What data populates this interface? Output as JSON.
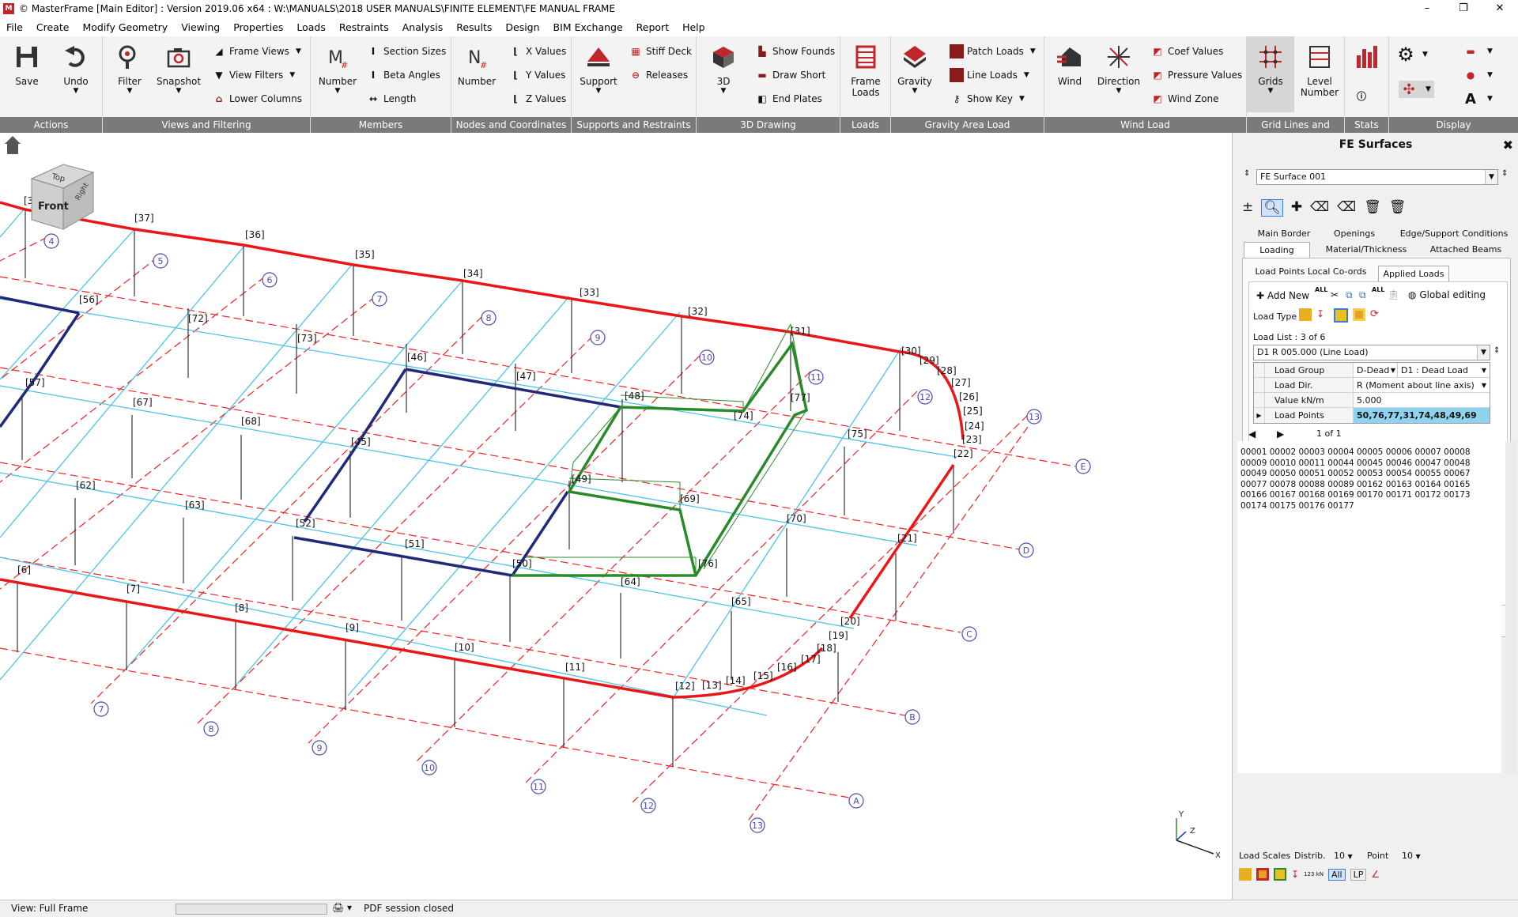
{
  "window": {
    "title": "© MasterFrame [Main Editor] : Version 2019.06 x64 : W:\\MANUALS\\2018 USER MANUALS\\FINITE ELEMENT\\FE MANUAL FRAME",
    "app_icon": "M",
    "controls": [
      "–",
      "❐",
      "✕"
    ]
  },
  "menu": [
    "File",
    "Create",
    "Modify Geometry",
    "Viewing",
    "Properties",
    "Loads",
    "Restraints",
    "Analysis",
    "Results",
    "Design",
    "BIM Exchange",
    "Report",
    "Help"
  ],
  "ribbon": {
    "groups": [
      "Actions",
      "Views and Filtering",
      "Members",
      "Nodes and Coordinates",
      "Supports and Restraints",
      "3D Drawing",
      "Loads",
      "Gravity Area Load",
      "Wind Load",
      "Grid Lines and Levels",
      "Stats",
      "Display"
    ],
    "save": "Save",
    "undo": "Undo",
    "filter": "Filter",
    "snapshot": "Snapshot",
    "frame_views": "Frame Views",
    "view_filters": "View Filters",
    "lower_columns": "Lower Columns",
    "number": "Number",
    "section_sizes": "Section Sizes",
    "beta_angles": "Beta Angles",
    "length": "Length",
    "node_number": "Number",
    "x_values": "X Values",
    "y_values": "Y Values",
    "z_values": "Z Values",
    "support": "Support",
    "stiff_deck": "Stiff Deck",
    "releases": "Releases",
    "three_d": "3D",
    "show_founds": "Show Founds",
    "draw_short": "Draw Short",
    "end_plates": "End Plates",
    "frame_loads": "Frame Loads",
    "gravity": "Gravity",
    "patch_loads": "Patch Loads",
    "line_loads": "Line Loads",
    "show_key": "Show Key",
    "wind": "Wind",
    "direction": "Direction",
    "coef_values": "Coef Values",
    "pressure_values": "Pressure Values",
    "wind_zone": "Wind Zone",
    "grids": "Grids",
    "level_number": "Level Number"
  },
  "canvas": {
    "view_cube": {
      "top": "Top",
      "front": "Front",
      "right": "Right"
    },
    "axis": {
      "x": "X",
      "y": "Y",
      "z": "Z"
    },
    "node_labels": [
      "[3]",
      "[37]",
      "[36]",
      "[35]",
      "[34]",
      "[33]",
      "[32]",
      "[31]",
      "[30]",
      "[29]",
      "[28]",
      "[27]",
      "[26]",
      "[25]",
      "[24]",
      "[23]",
      "[22]",
      "[21]",
      "[20]",
      "[19]",
      "[18]",
      "[17]",
      "[16]",
      "[15]",
      "[14]",
      "[13]",
      "[12]",
      "[11]",
      "[10]",
      "[9]",
      "[8]",
      "[7]",
      "[6]",
      "[56]",
      "[57]",
      "[72]",
      "[73]",
      "[46]",
      "[47]",
      "[48]",
      "[74]",
      "[77]",
      "[75]",
      "[67]",
      "[68]",
      "[45]",
      "[62]",
      "[63]",
      "[52]",
      "[51]",
      "[49]",
      "[69]",
      "[70]",
      "[50]",
      "[64]",
      "[76]",
      "[65]"
    ],
    "grid_bubbles": [
      "4",
      "5",
      "6",
      "7",
      "8",
      "9",
      "10",
      "11",
      "12",
      "13",
      "7",
      "8",
      "9",
      "10",
      "11",
      "12",
      "13",
      "A",
      "B",
      "C",
      "D",
      "E"
    ]
  },
  "panel": {
    "title": "FE Surfaces",
    "surface_select": "FE Surface 001",
    "tabs_row1": [
      "Main Border",
      "Openings",
      "Edge/Support Conditions"
    ],
    "tabs_row2": [
      "Loading",
      "Material/Thickness",
      "Attached Beams"
    ],
    "subtabs": [
      "Load Points Local Co-ords",
      "Applied Loads"
    ],
    "add_new": "Add New",
    "all_label": "ALL",
    "global_editing": "Global editing",
    "load_type_label": "Load Type",
    "load_list_label": "Load List :  3 of 6",
    "load_list_value": "D1 R 005.000 (Line Load)",
    "props": [
      {
        "name": "Load Group",
        "value": "D-Dead",
        "value2": "D1 : Dead Load"
      },
      {
        "name": "Load Dir.",
        "value": "R (Moment about line axis)"
      },
      {
        "name": "Value kN/m",
        "value": "5.000"
      },
      {
        "name": "Load Points",
        "value": "50,76,77,31,74,48,49,69"
      }
    ],
    "page_indicator": "1 of 1",
    "member_list": "00001 00002 00003 00004 00005 00006 00007 00008 00009 00010 00011 00044 00045 00046 00047 00048 00049 00050 00051 00052 00053 00054 00055 00067 00077 00078 00088 00089 00162 00163 00164 00165 00166 00167 00168 00169 00170 00171 00172 00173 00174 00175 00176 00177",
    "load_scales_label": "Load Scales",
    "distrib_label": "Distrib.",
    "distrib_value": "10",
    "point_label": "Point",
    "point_value": "10",
    "btn_all": "All",
    "btn_lp": "LP",
    "kn_label": "123 kN"
  },
  "status": {
    "view": "View: Full Frame",
    "pdf": "PDF session closed"
  }
}
